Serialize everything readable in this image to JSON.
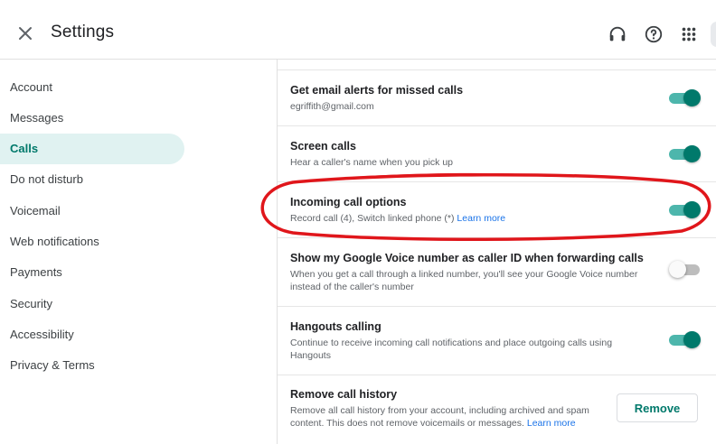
{
  "header": {
    "title": "Settings",
    "icons": [
      "close-icon",
      "headset-icon",
      "help-icon",
      "apps-grid-icon"
    ]
  },
  "sidebar": {
    "items": [
      {
        "label": "Account",
        "active": false
      },
      {
        "label": "Messages",
        "active": false
      },
      {
        "label": "Calls",
        "active": true
      },
      {
        "label": "Do not disturb",
        "active": false
      },
      {
        "label": "Voicemail",
        "active": false
      },
      {
        "label": "Web notifications",
        "active": false
      },
      {
        "label": "Payments",
        "active": false
      },
      {
        "label": "Security",
        "active": false
      },
      {
        "label": "Accessibility",
        "active": false
      },
      {
        "label": "Privacy & Terms",
        "active": false
      }
    ]
  },
  "settings": {
    "missed_call_alerts": {
      "title": "Get email alerts for missed calls",
      "subtitle": "egriffith@gmail.com",
      "enabled": true
    },
    "screen_calls": {
      "title": "Screen calls",
      "subtitle": "Hear a caller's name when you pick up",
      "enabled": true
    },
    "incoming_call_options": {
      "title": "Incoming call options",
      "subtitle": "Record call (4), Switch linked phone (*)",
      "link": "Learn more",
      "enabled": true
    },
    "show_gv_caller_id": {
      "title": "Show my Google Voice number as caller ID when forwarding calls",
      "subtitle": "When you get a call through a linked number, you'll see your Google Voice number instead of the caller's number",
      "enabled": false
    },
    "hangouts_calling": {
      "title": "Hangouts calling",
      "subtitle": "Continue to receive incoming call notifications and place outgoing calls using Hangouts",
      "enabled": true
    },
    "remove_call_history": {
      "title": "Remove call history",
      "subtitle": "Remove all call history from your account, including archived and spam content. This does not remove voicemails or messages.",
      "link": "Learn more",
      "button_label": "Remove"
    }
  },
  "colors": {
    "accent": "#00796b",
    "active_nav_bg": "#e0f2f1",
    "toggle_track_on": "#4db6ac",
    "link": "#1a73e8",
    "annotation": "#e0161b"
  }
}
